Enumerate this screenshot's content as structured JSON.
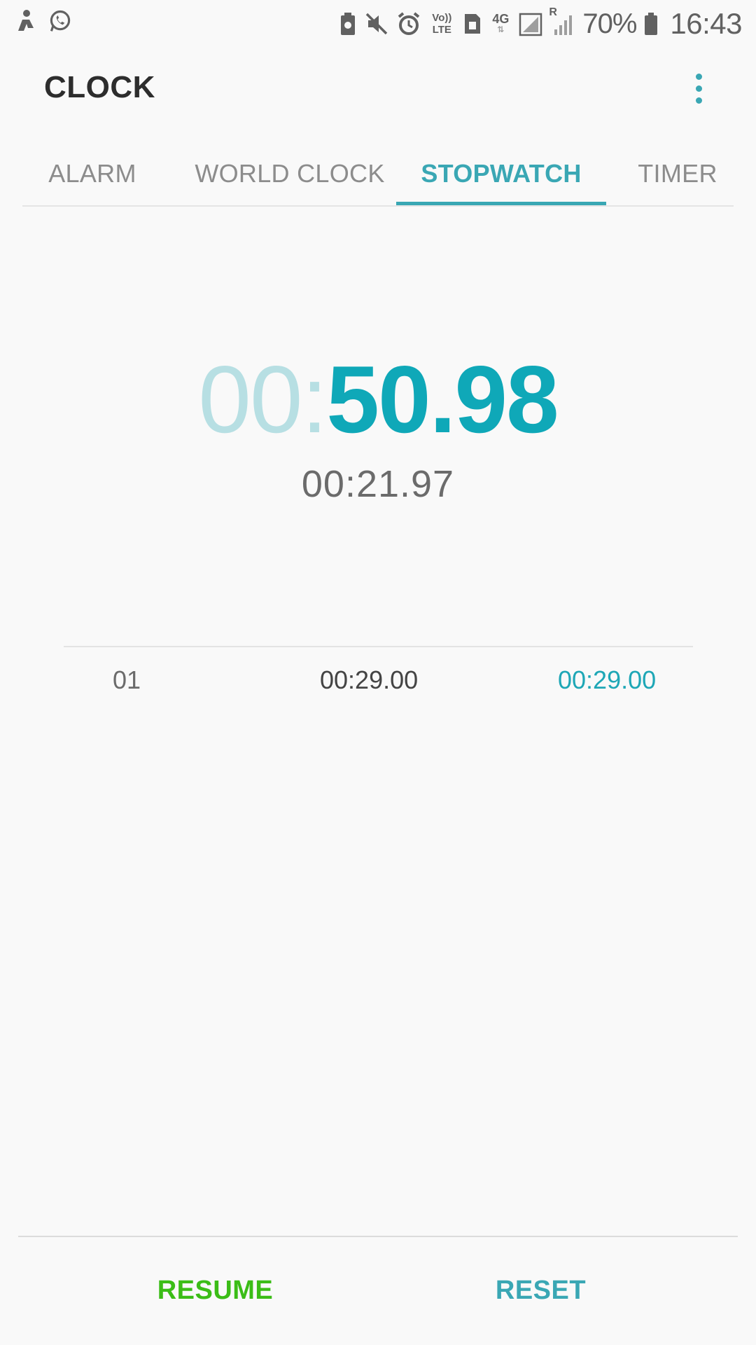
{
  "status_bar": {
    "left_icons": [
      "person-notification-icon",
      "whatsapp-icon"
    ],
    "right_icons": [
      "battery-saver-icon",
      "mute-icon",
      "alarm-icon",
      "volte-icon",
      "sim-icon",
      "4g-icon",
      "signal-icon",
      "roaming-signal-icon",
      "battery-icon"
    ],
    "volte_top": "Vo))",
    "volte_bottom": "LTE",
    "network_type": "4G",
    "roaming_letter": "R",
    "battery_percent": "70%",
    "time": "16:43"
  },
  "app_bar": {
    "title": "CLOCK",
    "more_icon": "more-vert-icon"
  },
  "tabs": [
    {
      "label": "ALARM",
      "active": false
    },
    {
      "label": "WORLD CLOCK",
      "active": false
    },
    {
      "label": "STOPWATCH",
      "active": true
    },
    {
      "label": "TIMER",
      "active": false
    }
  ],
  "stopwatch": {
    "minutes": "00",
    "separator": ":",
    "seconds": "50.98",
    "current_lap_time": "00:21.97"
  },
  "laps": [
    {
      "number": "01",
      "lap_time": "00:29.00",
      "total_time": "00:29.00"
    }
  ],
  "buttons": {
    "resume_label": "RESUME",
    "reset_label": "RESET"
  },
  "colors": {
    "accent": "#3aa7b4",
    "seconds_text": "#0fa8b8",
    "minutes_text": "#b7dfe3",
    "resume": "#3bbd17",
    "background": "#f9f9f9"
  }
}
